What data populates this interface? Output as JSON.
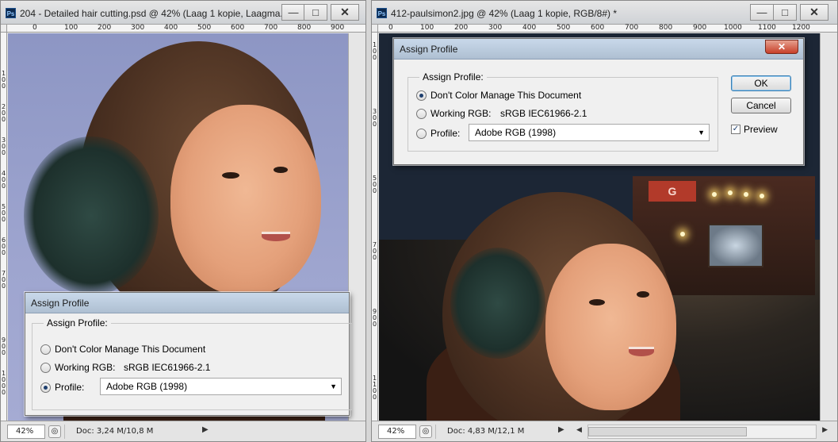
{
  "left_window": {
    "title": "204 - Detailed hair cutting.psd @ 42% (Laag 1 kopie, Laagma...",
    "ps_badge": "Ps",
    "buttons": {
      "minimize": "—",
      "maximize": "□",
      "close": "✕"
    },
    "ruler_h": [
      "0",
      "100",
      "200",
      "300",
      "400",
      "500",
      "600",
      "700",
      "800",
      "900"
    ],
    "ruler_v": [
      "1 0 0",
      "2 0 0",
      "3 0 0",
      "4 0 0",
      "5 0 0",
      "6 0 0",
      "7 0 0",
      "8 0 0",
      "9 0 0",
      "1 0 0 0",
      "1 1 0 0"
    ],
    "status": {
      "zoom": "42%",
      "doc": "Doc: 3,24 M/10,8 M",
      "arrow": "▶"
    },
    "dialog": {
      "title": "Assign Profile",
      "group_label": "Assign Profile:",
      "option_none": "Don't Color Manage This Document",
      "option_working": "Working RGB:",
      "working_value": "sRGB IEC61966-2.1",
      "option_profile": "Profile:",
      "profile_value": "Adobe RGB (1998)",
      "selected": "profile"
    }
  },
  "right_window": {
    "title": "412-paulsimon2.jpg @ 42% (Laag 1 kopie, RGB/8#) *",
    "ps_badge": "Ps",
    "buttons": {
      "minimize": "—",
      "maximize": "□",
      "close": "✕"
    },
    "ruler_h": [
      "0",
      "100",
      "200",
      "300",
      "400",
      "500",
      "600",
      "700",
      "800",
      "900",
      "1000",
      "1100",
      "1200"
    ],
    "ruler_v": [
      "1 0 0",
      "2 0 0",
      "3 0 0",
      "4 0 0",
      "5 0 0",
      "6 0 0",
      "7 0 0",
      "8 0 0",
      "9 0 0",
      "1 0 0 0",
      "1 1 0 0"
    ],
    "status": {
      "zoom": "42%",
      "doc": "Doc: 4,83 M/12,1 M",
      "arrow": "▶",
      "scroll_left": "◀",
      "scroll_right": "▶"
    },
    "banner_text": "G",
    "dialog": {
      "title": "Assign Profile",
      "close": "✕",
      "group_label": "Assign Profile:",
      "option_none": "Don't Color Manage This Document",
      "option_working": "Working RGB:",
      "working_value": "sRGB IEC61966-2.1",
      "option_profile": "Profile:",
      "profile_value": "Adobe RGB (1998)",
      "selected": "none",
      "ok_label": "OK",
      "cancel_label": "Cancel",
      "preview_label": "Preview",
      "preview_checked": true
    }
  },
  "colors": {
    "dialog_title_bar": "#c9d9ea",
    "close_button": "#c8402a",
    "default_button_border": "#3c7fb1",
    "left_background": "#9ea5cf"
  },
  "icons": [
    "photoshop-badge-icon",
    "minimize-icon",
    "maximize-icon",
    "close-icon",
    "chevron-down-icon",
    "status-menu-icon",
    "arrow-right-icon",
    "arrow-left-icon",
    "checkmark-icon"
  ]
}
